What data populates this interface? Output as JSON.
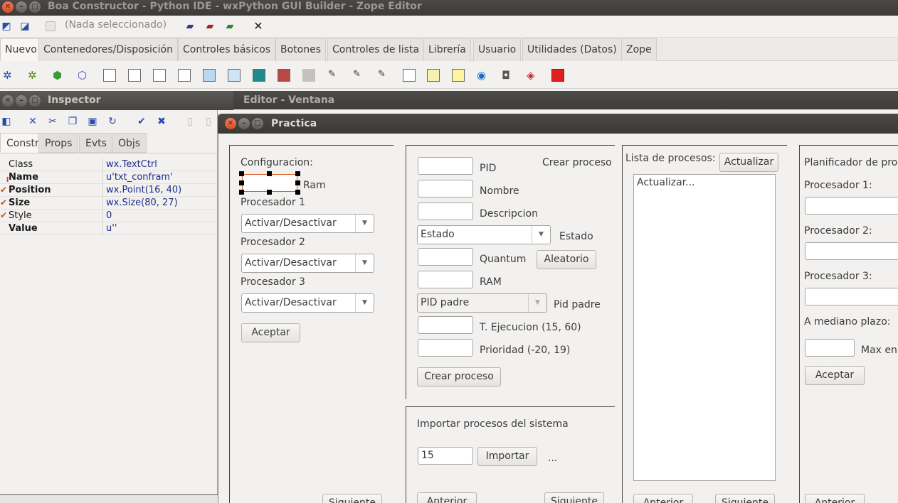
{
  "ide": {
    "title": "Boa Constructor - Python IDE - wxPython GUI Builder - Zope Editor",
    "selection_label": "(Nada seleccionado)"
  },
  "palette": {
    "tabs": [
      "Nuevo",
      "Contenedores/Disposición",
      "Controles básicos",
      "Botones",
      "Controles de lista",
      "Librería",
      "Usuario",
      "Utilidades (Datos)",
      "Zope"
    ],
    "active_tab": "Nuevo"
  },
  "inspector": {
    "title": "Inspector",
    "tabs": [
      "Constr",
      "Props",
      "Evts",
      "Objs"
    ],
    "active_tab": "Constr",
    "properties": [
      {
        "name": "Class",
        "value": "wx.TextCtrl",
        "bold": false,
        "checked": false
      },
      {
        "name": "Name",
        "value": "u'txt_confram'",
        "bold": true,
        "checked": false
      },
      {
        "name": "Position",
        "value": "wx.Point(16, 40)",
        "bold": true,
        "checked": true
      },
      {
        "name": "Size",
        "value": "wx.Size(80, 27)",
        "bold": true,
        "checked": true
      },
      {
        "name": "Style",
        "value": "0",
        "bold": false,
        "checked": true
      },
      {
        "name": "Value",
        "value": "u''",
        "bold": true,
        "checked": false
      }
    ]
  },
  "editor": {
    "title": "Editor - Ventana"
  },
  "practica": {
    "title": "Practica",
    "config": {
      "heading": "Configuracion:",
      "ram_label": "Ram",
      "processors": [
        {
          "label": "Procesador 1",
          "value": "Activar/Desactivar"
        },
        {
          "label": "Procesador 2",
          "value": "Activar/Desactivar"
        },
        {
          "label": "Procesador 3",
          "value": "Activar/Desactivar"
        }
      ],
      "accept_button": "Aceptar",
      "next_button": "Siguiente"
    },
    "create": {
      "heading": "Crear proceso",
      "pid_label": "PID",
      "name_label": "Nombre",
      "desc_label": "Descripcion",
      "state_combo": "Estado",
      "state_label": "Estado",
      "quantum_label": "Quantum",
      "random_button": "Aleatorio",
      "ram_label": "RAM",
      "parent_combo": "PID padre",
      "parent_label": "Pid padre",
      "exec_label": "T. Ejecucion (15, 60)",
      "priority_label": "Prioridad (-20, 19)",
      "create_button": "Crear proceso"
    },
    "import": {
      "heading": "Importar procesos del sistema",
      "count_value": "15",
      "import_button": "Importar",
      "ellipsis": "...",
      "prev_button": "Anterior",
      "next_button": "Siguiente"
    },
    "process_list": {
      "heading": "Lista de procesos:",
      "update_button": "Actualizar",
      "items": [
        "Actualizar..."
      ],
      "prev_button": "Anterior",
      "next_button": "Siguiente"
    },
    "planner": {
      "heading": "Planificador de proc",
      "p1_label": "Procesador 1:",
      "p2_label": "Procesador 2:",
      "p3_label": "Procesador 3:",
      "medium_label": "A mediano plazo:",
      "max_label": "Max en",
      "accept_button": "Aceptar",
      "prev_button": "Anterior"
    }
  }
}
